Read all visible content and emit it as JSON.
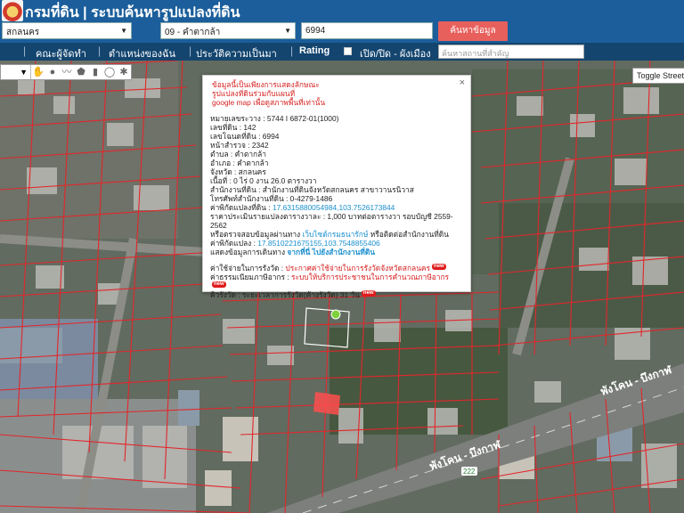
{
  "header": {
    "title": "กรมที่ดิน | ระบบค้นหารูปแปลงที่ดิน",
    "province": "สกลนคร",
    "district": "09 - คำตากล้า",
    "parcel_no": "6994",
    "search_label": "ค้นหาข้อมูล"
  },
  "nav": {
    "guide": "คณะผู้จัดทำ",
    "position": "ตำแหน่งของฉัน",
    "history": "ประวัติความเป็นมา",
    "rating": "Rating",
    "toggle_label": "เปิด/ปิด - ผังเมือง",
    "place_placeholder": "ค้นหาสถานที่สำคัญ"
  },
  "map": {
    "toggle_street": "Toggle Street View",
    "road_label_1": "พังโคน - บึงกาฬ",
    "road_label_2": "พังโคน - บึงกาฬ",
    "road_marker": "222",
    "colors": {
      "parcel": "#e3262b",
      "road": "#7d7f7c",
      "selected": "#ff4d4d"
    }
  },
  "popup": {
    "note": [
      "ข้อมูลนี้เป็นเพียงการแสดงลักษณะ",
      "รูปแปลงที่ดินร่วมกับแผนที่",
      "google map เพื่อดูสภาพพื้นที่เท่านั้น"
    ],
    "rows": [
      "หมายเลขระวาง : 5744 I 6872-01(1000)",
      "เลขที่ดิน : 142",
      "เลขโฉนดที่ดิน : 6994",
      "หน้าสำรวจ : 2342",
      "ตำบล : คำตากล้า",
      "อำเภอ : คำตากล้า",
      "จังหวัด : สกลนคร",
      "เนื้อที่ : 0 ไร่ 0 งาน 26.0 ตารางวา",
      "สำนักงานที่ดิน : สำนักงานที่ดินจังหวัดสกลนคร สาขาวานรนิวาส",
      "โทรศัพท์สำนักงานที่ดิน : 0-4279-1486"
    ],
    "centroid_label": "ค่าพิกัดแปลงที่ดิน : ",
    "centroid_value": "17.6315880054984,103.7526173844",
    "price_line": "ราคาประเมินรายแปลงตารางวาละ : 1,000 บาทต่อตารางวา รอบบัญชี 2559-2562",
    "check_prefix": "หรือตรวจสอบข้อมูลผ่านทาง ",
    "check_link": "เว็บไซต์กรมธนารักษ์",
    "check_suffix": " หรือติดต่อสำนักงานที่ดิน",
    "office_label": "ค่าพิกัดแปลง : ",
    "office_value": "17.8510221675155,103.7548855406",
    "route_prefix": "แสดงข้อมูลการเดินทาง ",
    "route_link": "จากที่นี่ ไปยังสำนักงานที่ดิน",
    "fee_prefix": "ค่าใช้จ่ายในการรังวัด : ",
    "fee_link": "ประกาศค่าใช้จ่ายในการรังวัดจังหวัดสกลนคร",
    "queue_prefix": "ค่าธรรมเนียมภาษีอากร : ",
    "queue_link": "ระบบให้บริการประชาชนในการคำนวณภาษีอากร",
    "wait_prefix": "คิวรังวัด : ",
    "wait_text": "ระยะเวลาการรังวัด(ค้างรังวัด) 31 วัน",
    "new_badge": "new",
    "close": "×"
  }
}
